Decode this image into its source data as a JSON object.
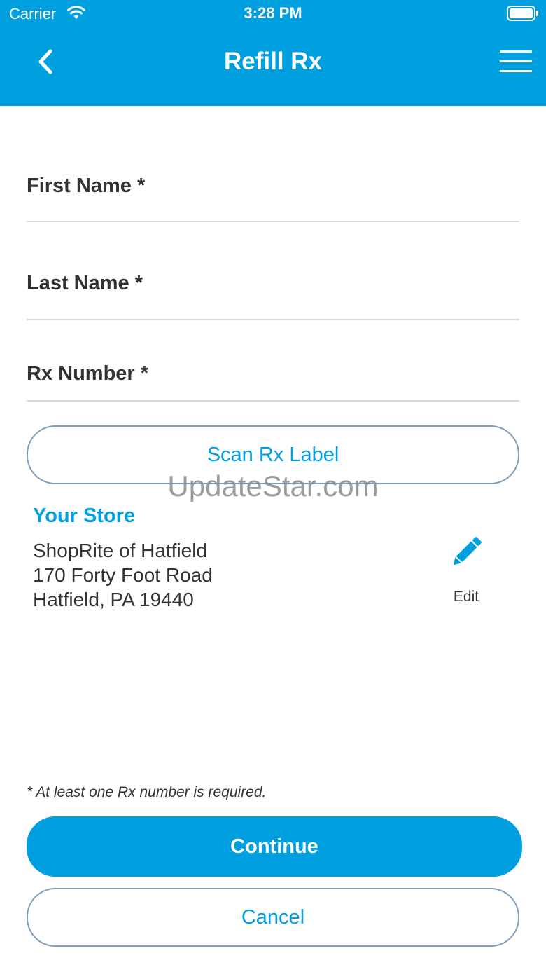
{
  "status_bar": {
    "carrier": "Carrier",
    "time": "3:28 PM",
    "wifi_icon": "wifi-icon",
    "battery_icon": "battery-icon"
  },
  "nav": {
    "title": "Refill Rx",
    "back_icon": "chevron-left-icon",
    "menu_icon": "hamburger-menu-icon"
  },
  "form": {
    "first_name_label": "First Name *",
    "first_name_value": "",
    "last_name_label": "Last Name *",
    "last_name_value": "",
    "rx_number_label": "Rx Number *",
    "rx_number_value": ""
  },
  "scan_button_label": "Scan Rx Label",
  "watermark": "UpdateStar.com",
  "store": {
    "heading": "Your Store",
    "name": "ShopRite of Hatfield",
    "street": "170 Forty Foot Road",
    "city_state_zip": "Hatfield, PA 19440",
    "edit_label": "Edit",
    "edit_icon": "pencil-icon"
  },
  "note": "* At least one Rx number is required.",
  "continue_label": "Continue",
  "cancel_label": "Cancel",
  "colors": {
    "brand_blue": "#009fdf",
    "text_dark": "#333333",
    "divider": "#d9d9d9",
    "outline": "#7f9fbd"
  }
}
